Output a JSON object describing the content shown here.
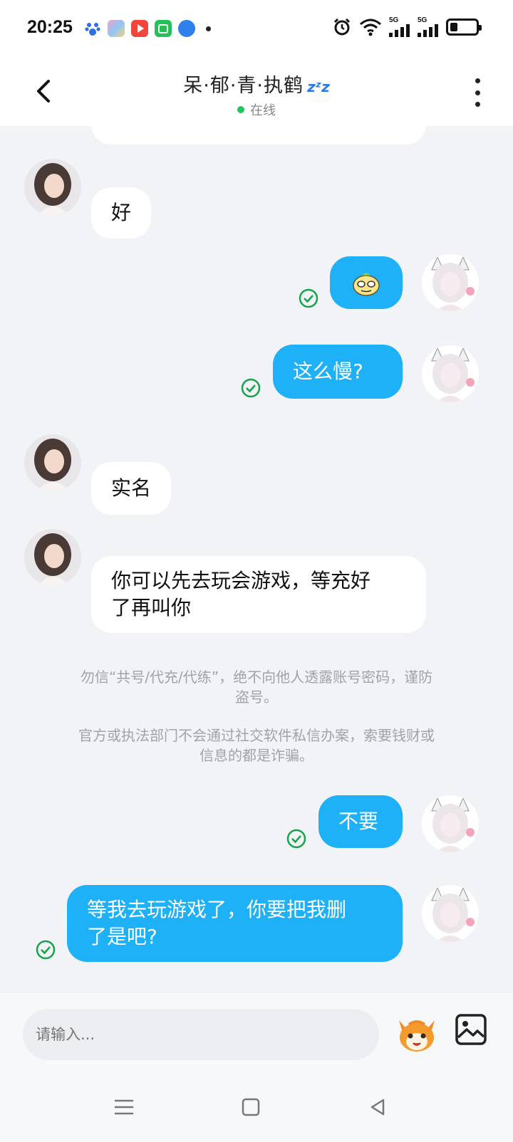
{
  "status_bar": {
    "time": "20:25",
    "net_left": "5G",
    "net_right": "5G"
  },
  "header": {
    "title": "呆·郁·青·执鹤",
    "zzz": "zᶻz",
    "status": "在线"
  },
  "messages": [
    {
      "side": "in",
      "text": "好"
    },
    {
      "side": "out",
      "text": "",
      "sticker": "sticker-face"
    },
    {
      "side": "out",
      "text": "这么慢?"
    },
    {
      "side": "in",
      "text": "实名"
    },
    {
      "side": "in",
      "text_line1": "你可以先去玩会游戏，等充好",
      "text_line2": "了再叫你"
    },
    {
      "side": "out",
      "text": "不要"
    },
    {
      "side": "out",
      "text_line1": "等我去玩游戏了，你要把我删",
      "text_line2": "了是吧?"
    }
  ],
  "notice": {
    "line1": "勿信“共号/代充/代练”，绝不向他人透露账号密码，谨防",
    "line2": "盗号。",
    "line3": "官方或执法部门不会通过社交软件私信办案，索要钱财或",
    "line4": "信息的都是诈骗。"
  },
  "input": {
    "placeholder": "请输入..."
  },
  "colors": {
    "outgoing": "#1fb1f8",
    "incoming": "#ffffff",
    "online": "#22c55e",
    "check": "#16a34a"
  }
}
